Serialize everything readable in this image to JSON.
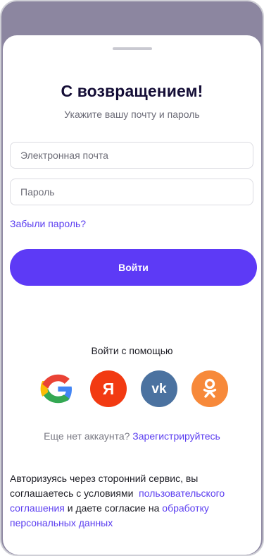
{
  "title": "С возвращением!",
  "subtitle": "Укажите вашу почту и пароль",
  "email": {
    "placeholder": "Электронная почта",
    "value": ""
  },
  "password": {
    "placeholder": "Пароль",
    "value": ""
  },
  "forgot_link": "Забыли пароль?",
  "login_button": "Войти",
  "social": {
    "label": "Войти с помощью",
    "providers": [
      {
        "name": "Google",
        "icon": "google-icon",
        "color": "#ffffff"
      },
      {
        "name": "Яндекс",
        "icon": "yandex-icon",
        "glyph": "Я",
        "color": "#f23a12"
      },
      {
        "name": "ВКонтакте",
        "icon": "vk-icon",
        "glyph": "vk",
        "color": "#4b72a0"
      },
      {
        "name": "Одноклассники",
        "icon": "ok-icon",
        "color": "#f7893a"
      }
    ]
  },
  "signup": {
    "text": "Еще нет аккаунта?",
    "link": "Зарегистрируйтесь"
  },
  "terms": {
    "part1": "Авторизуясь через сторонний сервис, вы соглашаетесь с условиями",
    "link1": "пользовательского соглашения",
    "part2": "и даете согласие на",
    "link2": "обработку персональных данных"
  },
  "colors": {
    "accent": "#5d3af6",
    "link": "#5b3ef0",
    "title": "#140d36",
    "backdrop": "#8c86a0"
  }
}
